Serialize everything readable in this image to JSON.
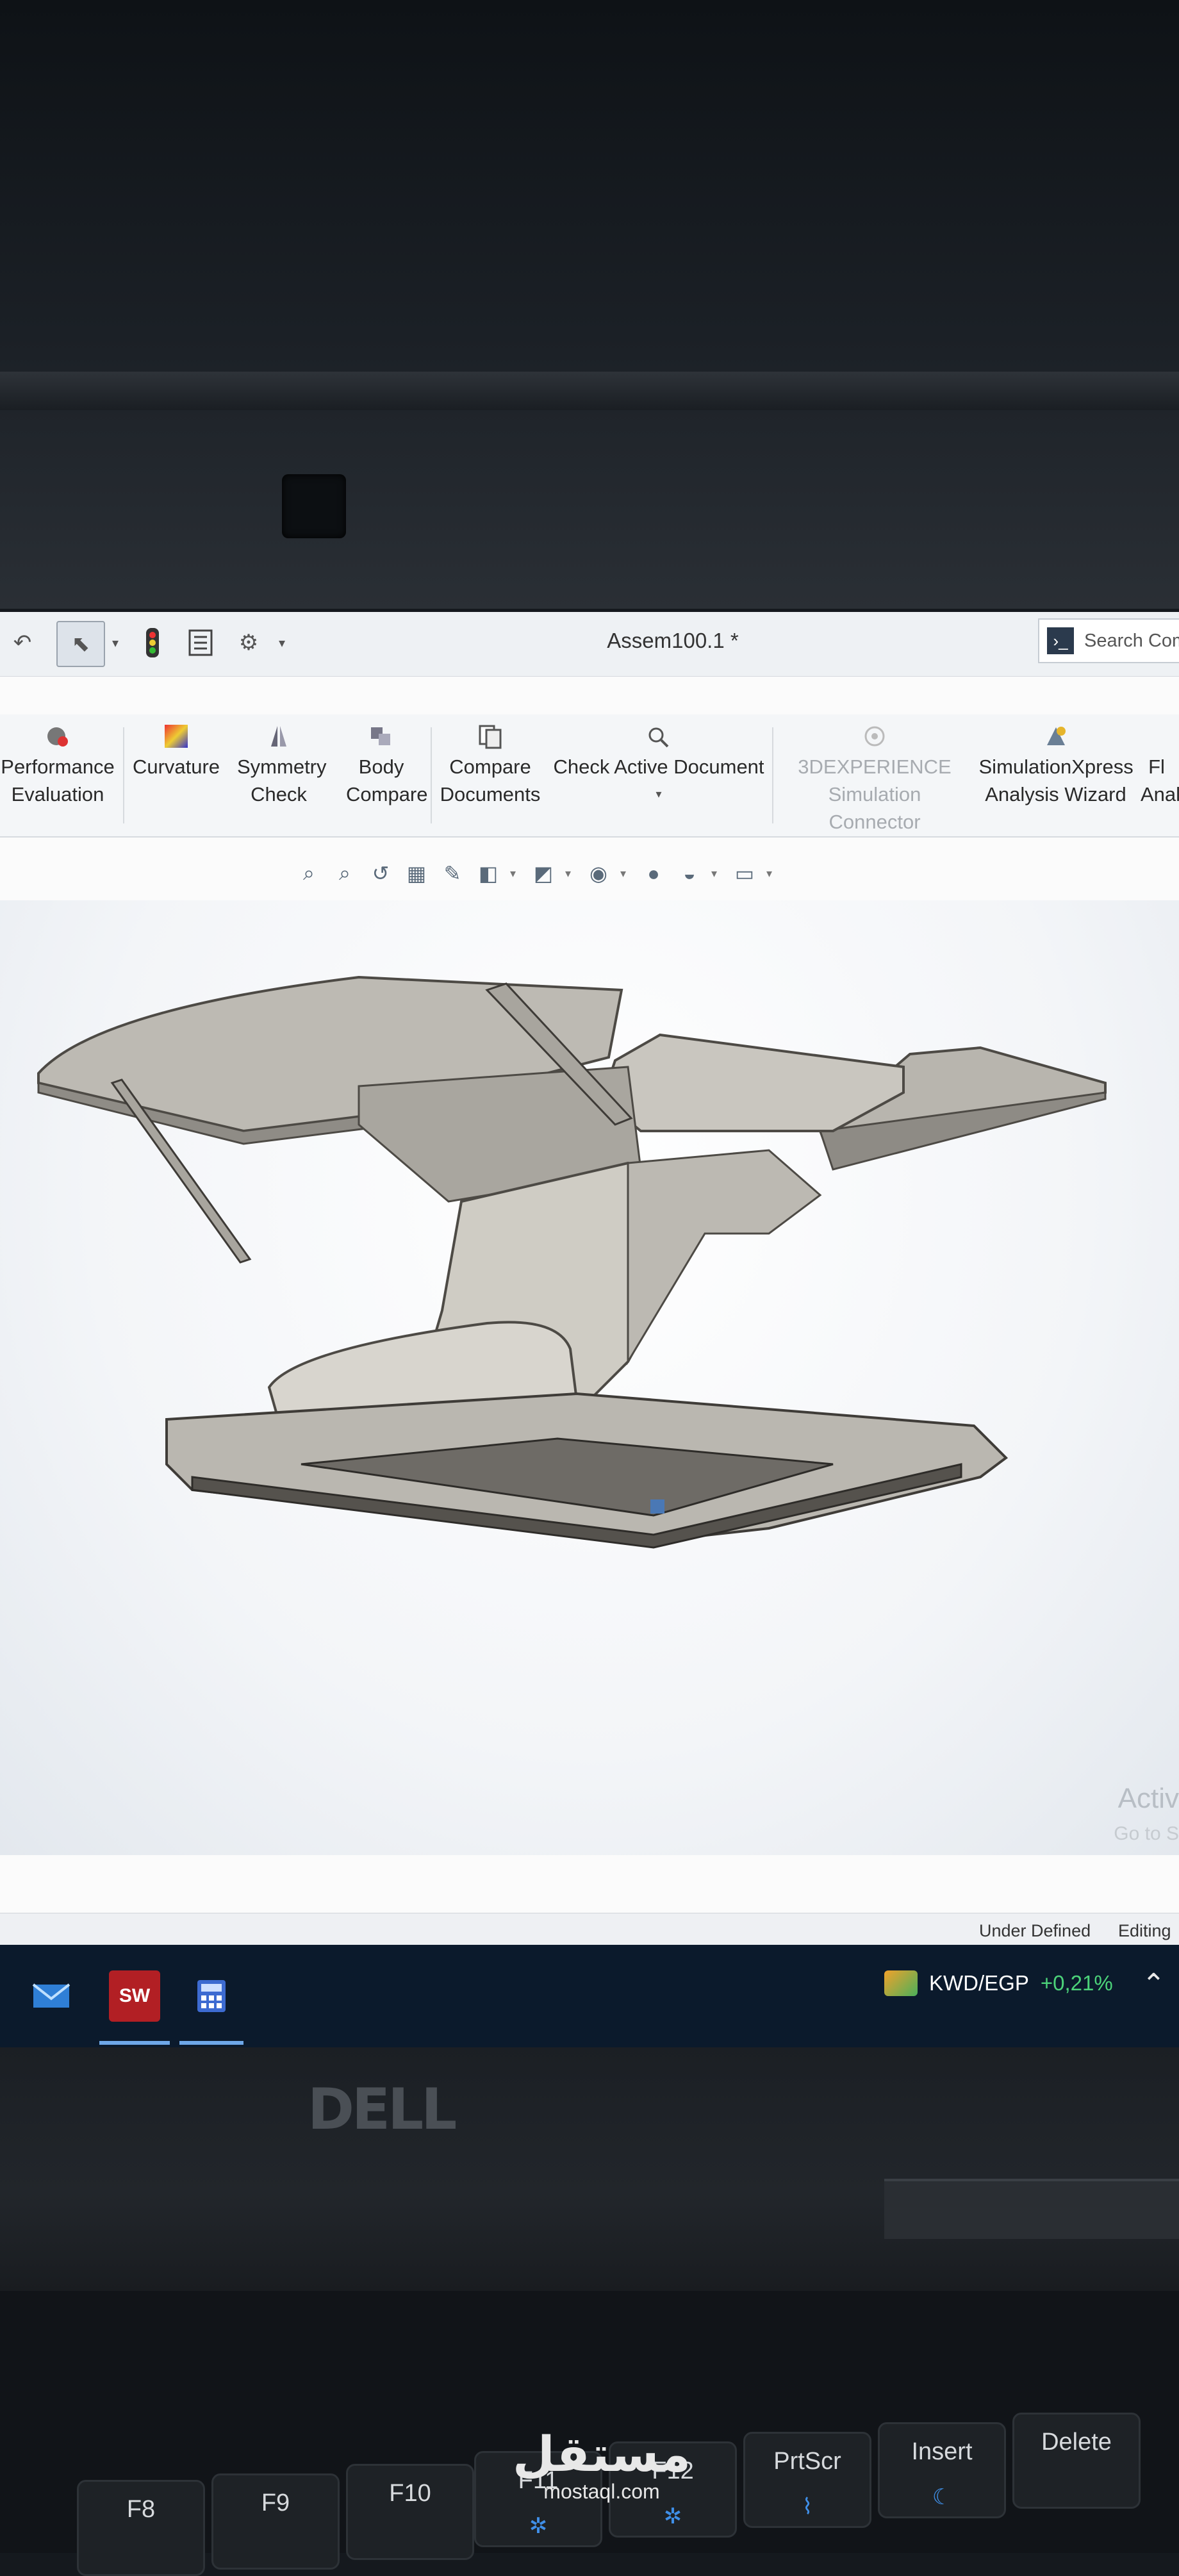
{
  "window": {
    "title": "Assem100.1 *"
  },
  "search": {
    "placeholder": "Search Com"
  },
  "ribbon": {
    "items": [
      {
        "label": "Performance Evaluation",
        "icon": "performance-evaluation-icon",
        "enabled": true
      },
      {
        "label": "Curvature",
        "icon": "curvature-icon",
        "enabled": true
      },
      {
        "label": "Symmetry Check",
        "icon": "symmetry-check-icon",
        "enabled": true
      },
      {
        "label": "Body Compare",
        "icon": "body-compare-icon",
        "enabled": true
      },
      {
        "label": "Compare Documents",
        "icon": "compare-documents-icon",
        "enabled": true
      },
      {
        "label": "Check Active Document",
        "icon": "check-active-document-icon",
        "enabled": true
      },
      {
        "label": "3DEXPERIENCE Simulation Connector",
        "icon": "simulation-connector-icon",
        "enabled": false
      },
      {
        "label": "SimulationXpress Analysis Wizard",
        "icon": "simulationxpress-icon",
        "enabled": true
      },
      {
        "label": "Fl Anal",
        "icon": "flow-analysis-icon",
        "enabled": true
      }
    ]
  },
  "graphics": {
    "watermark": "Activ",
    "watermark_sub": "Go to S"
  },
  "statusbar": {
    "state": "Under Defined",
    "mode": "Editing"
  },
  "taskbar": {
    "apps": [
      "mail-icon",
      "solidworks-icon",
      "calculator-icon"
    ],
    "solidworks_label": "SW",
    "ticker": {
      "pair": "KWD/EGP",
      "change": "+0,21%"
    }
  },
  "device": {
    "brand": "DELL",
    "keys": [
      {
        "label": "F8",
        "glyph": ""
      },
      {
        "label": "F9",
        "glyph": ""
      },
      {
        "label": "F10",
        "glyph": ""
      },
      {
        "label": "F11",
        "glyph": "✲"
      },
      {
        "label": "F12",
        "glyph": "✲"
      },
      {
        "label": "PrtScr",
        "glyph": "⌇"
      },
      {
        "label": "Insert",
        "glyph": "☾"
      },
      {
        "label": "Delete",
        "glyph": ""
      }
    ]
  },
  "overlay": {
    "site_ar": "مستقل",
    "site_en": "mostaql.com"
  }
}
